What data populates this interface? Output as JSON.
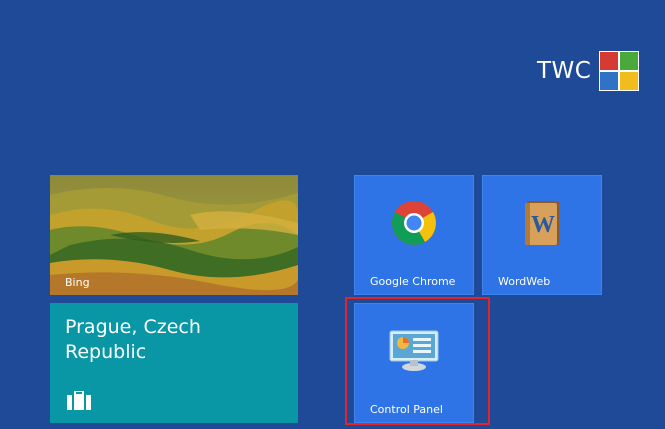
{
  "brand": {
    "text": "TWC"
  },
  "tiles": {
    "bing": {
      "label": "Bing",
      "icon": "wheat-fields-photo"
    },
    "travel": {
      "title": "Prague, Czech Republic",
      "icon": "suitcase-icon"
    },
    "chrome": {
      "label": "Google Chrome",
      "icon": "chrome-icon"
    },
    "wordweb": {
      "label": "WordWeb",
      "icon": "wordweb-book-icon"
    },
    "control_panel": {
      "label": "Control Panel",
      "icon": "control-panel-icon"
    }
  },
  "colors": {
    "background": "#1e4a97",
    "app_tile": "#2e74e6",
    "travel_tile": "#0997a6",
    "highlight": "#e3242b"
  }
}
